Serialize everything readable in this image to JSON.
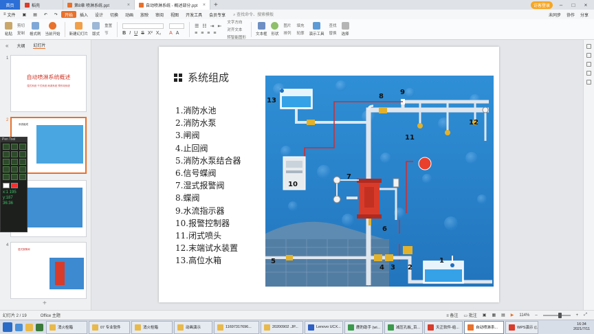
{
  "window": {
    "tabs": [
      {
        "label": "首页",
        "type": "home"
      },
      {
        "label": "稻壳",
        "type": "wps"
      },
      {
        "label": "第8章 喷淋系统.ppt",
        "type": "ppt"
      },
      {
        "label": "自动喷淋系统 - 概述部分.ppt",
        "type": "ppt",
        "active": true
      }
    ],
    "login_label": "访客登录"
  },
  "menubar": {
    "file_label": "文件",
    "items": [
      "开始",
      "插入",
      "设计",
      "切换",
      "动画",
      "放映",
      "审阅",
      "视图",
      "开发工具",
      "会员专享"
    ],
    "active_index": 0,
    "search_placeholder": "查找命令、搜索模板",
    "right_items": [
      "未同步",
      "协作",
      "分享"
    ]
  },
  "ribbon": {
    "paste": "粘贴",
    "clip": [
      "剪切",
      "复制",
      "格式刷"
    ],
    "from_start": "当前开始",
    "new_slide": "新建幻灯片",
    "layout": "版式",
    "section": "节",
    "reset": "重置",
    "text_direction": "文字方向",
    "align_text": "对齐文本",
    "convert_smartart": "转智能图形",
    "textbox": "文本框",
    "shape": "形状",
    "picture": "图片",
    "fill": "填充",
    "arrange": "排列",
    "outline": "轮廓",
    "presenter_tools": "演示工具",
    "find": "查找",
    "replace": "替换",
    "select": "选择"
  },
  "leftpanel": {
    "tab_outline": "大纲",
    "tab_slides": "幻灯片",
    "thumbs": [
      {
        "num": "1",
        "title": "自动喷淋系统概述",
        "sub": "湿式系统  干式系统  雨淋系统  预作用系统"
      },
      {
        "num": "2",
        "title": "系统组成"
      },
      {
        "num": "3",
        "title": ""
      },
      {
        "num": "4",
        "title": "湿式报警阀"
      }
    ],
    "selected_index": 1
  },
  "pentool": {
    "title": "Pen Tool",
    "readout_1": "x:1 195 y:187",
    "readout_2": "36:36"
  },
  "slide": {
    "title": "系统组成",
    "components": [
      "1.消防水池",
      "2.消防水泵",
      "3.闸阀",
      "4.止回阀",
      "5.消防水泵结合器",
      "6.信号蝶阀",
      "7.湿式报警阀",
      "8.蝶阀",
      "9.水流指示器",
      "10.报警控制器",
      "11.闭式喷头",
      "12.末端试水装置",
      "13.高位水箱"
    ],
    "diagram_labels": [
      "1",
      "2",
      "3",
      "4",
      "5",
      "6",
      "7",
      "8",
      "9",
      "10",
      "11",
      "12",
      "13"
    ]
  },
  "statusbar": {
    "slide_info": "幻灯片 2 / 19",
    "theme": "Office 主题",
    "notes": "备注",
    "comments": "批注",
    "zoom": "114%"
  },
  "taskbar": {
    "items": [
      {
        "label": "消火栓箱",
        "color": "#e9b949"
      },
      {
        "label": "07 专业软件",
        "color": "#e9b949"
      },
      {
        "label": "消火栓箱",
        "color": "#e9b949"
      },
      {
        "label": "动画演示",
        "color": "#e9b949"
      },
      {
        "label": "11697317696...",
        "color": "#e9b949"
      },
      {
        "label": "20200902 .JP...",
        "color": "#e9b949"
      },
      {
        "label": "Lenovo UCX...",
        "color": "#2d5fc4"
      },
      {
        "label": "鹿豹助手 (wi...",
        "color": "#3a9a4a"
      },
      {
        "label": "减压孔板_百...",
        "color": "#3a9a4a"
      },
      {
        "label": "天正软件-给...",
        "color": "#d93c2a"
      },
      {
        "label": "自动喷淋系...",
        "color": "#e8712b",
        "active": true
      },
      {
        "label": "WPS演示 ((...",
        "color": "#d93c2a"
      }
    ],
    "time": "16:34",
    "date": "2021/7/11"
  },
  "colors": {
    "accent": "#e8712b",
    "home_tab": "#2c6fd6",
    "water": "#2f8fd6",
    "pipe": "#dfe6ee",
    "red_pipe": "#d42a2a",
    "valve_red": "#d93b2a"
  }
}
